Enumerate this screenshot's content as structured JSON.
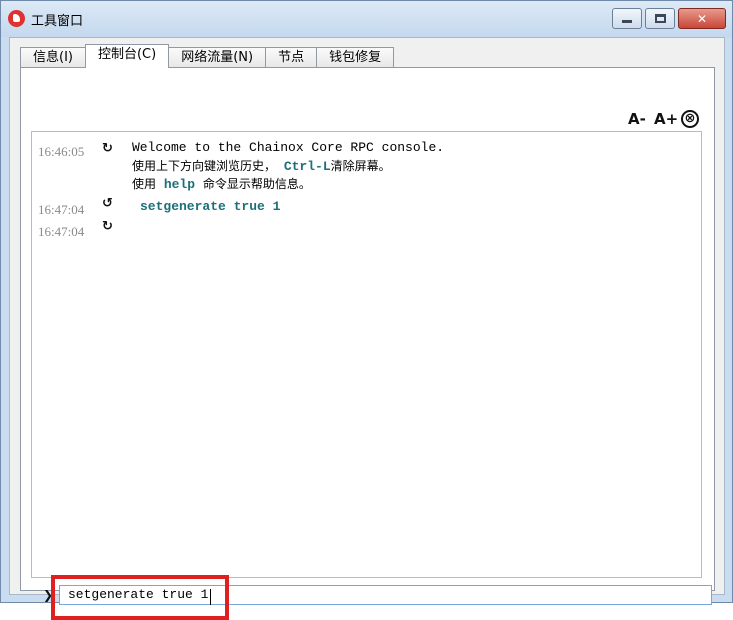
{
  "window": {
    "title": "工具窗口",
    "min_glyph": "",
    "close_glyph": "✕"
  },
  "tabs": [
    {
      "label": "信息(I)"
    },
    {
      "label": "控制台(C)"
    },
    {
      "label": "网络流量(N)"
    },
    {
      "label": "节点"
    },
    {
      "label": "钱包修复"
    }
  ],
  "active_tab": 1,
  "toolbar": {
    "font_decrease": "A-",
    "font_increase": "A+",
    "clear_glyph": "⊗"
  },
  "console": {
    "entries": [
      {
        "time": "16:46:05",
        "arrow": "↻",
        "line1": "Welcome to the Chainox Core RPC console.",
        "line2_a": "使用上下方向键浏览历史，",
        "line2_cmd": "Ctrl-L",
        "line2_b": "清除屏幕。",
        "line3_a": "使用",
        "line3_cmd": "help",
        "line3_b": "命令显示帮助信息。"
      },
      {
        "time": "16:47:04",
        "arrow": "↺",
        "text": "setgenerate true 1"
      },
      {
        "time": "16:47:04",
        "arrow": "↻",
        "text": ""
      }
    ]
  },
  "input": {
    "prompt_glyph": "❯",
    "value": "setgenerate true 1"
  },
  "colors": {
    "command": "#1d6f7a",
    "timestamp": "#8a8a8a",
    "highlight": "#e02020"
  }
}
